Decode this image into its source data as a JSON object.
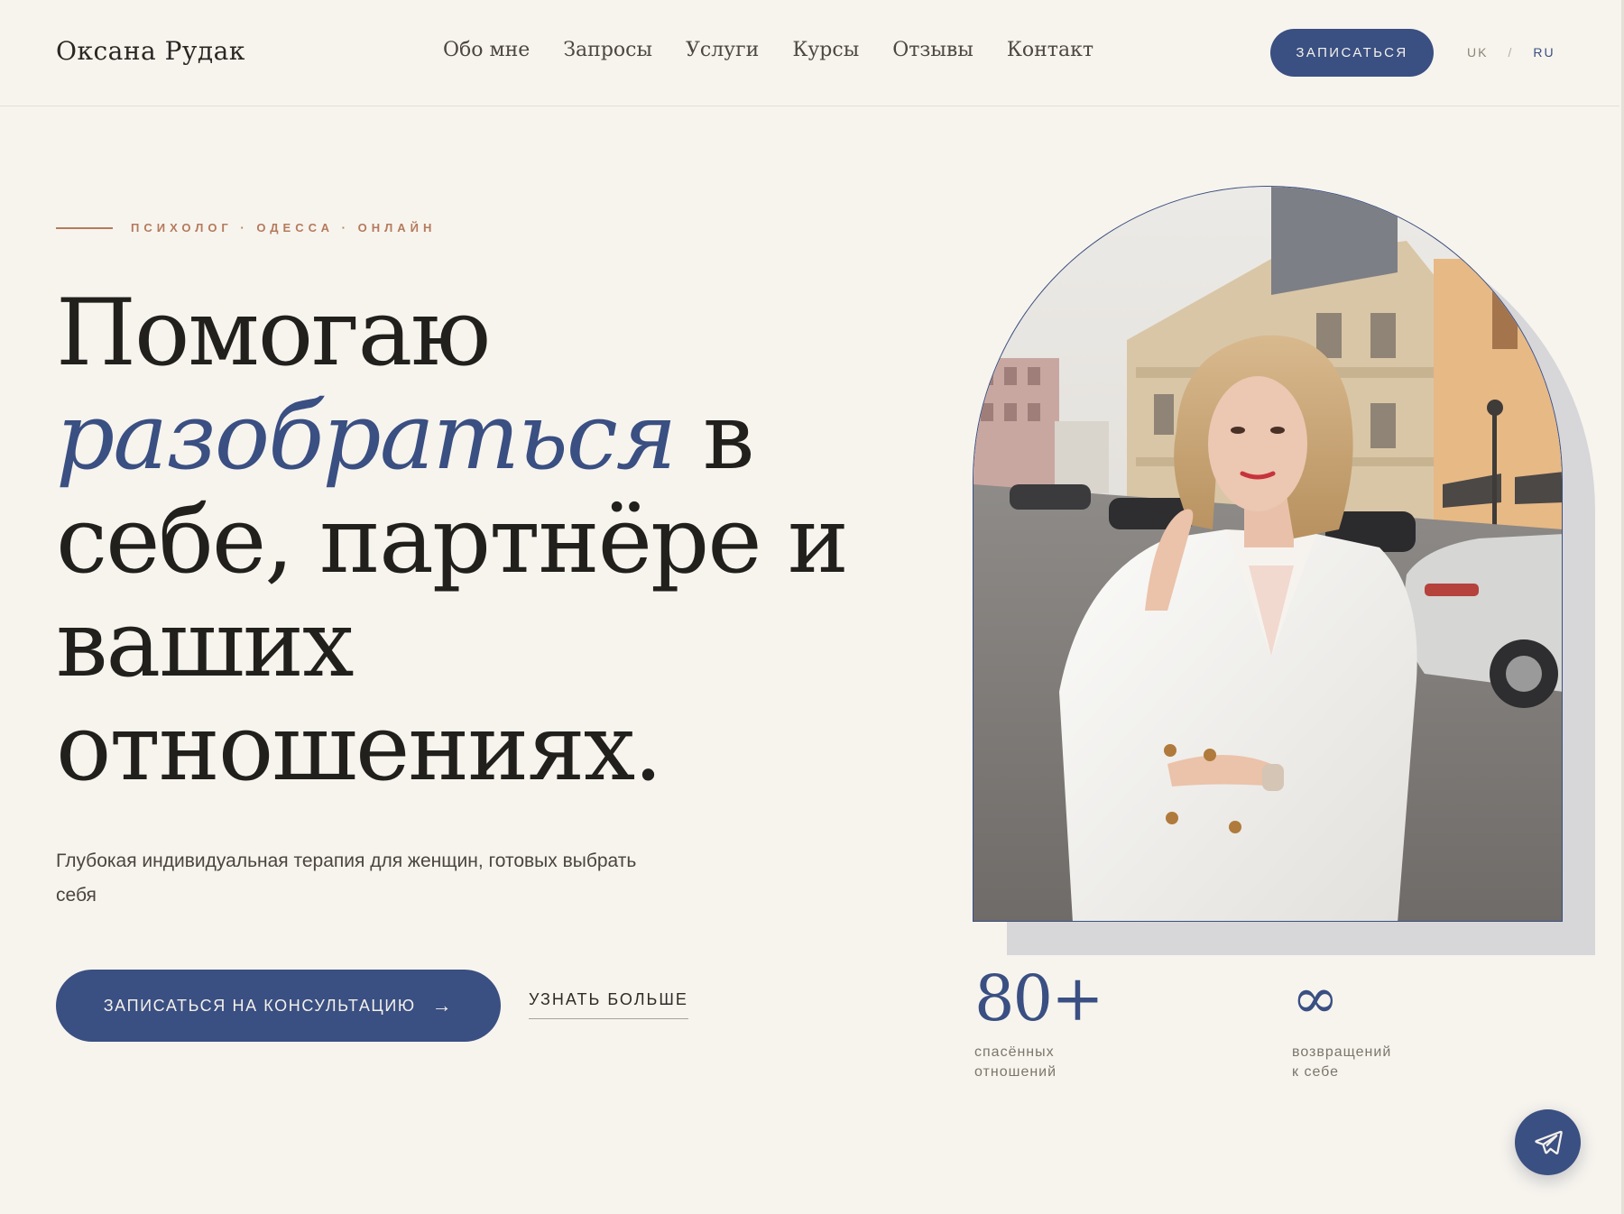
{
  "header": {
    "brand": "Оксана Рудак",
    "nav": [
      "Обо мне",
      "Запросы",
      "Услуги",
      "Курсы",
      "Отзывы",
      "Контакт"
    ],
    "cta_label": "ЗАПИСАТЬСЯ",
    "lang": {
      "uk": "UK",
      "separator": "/",
      "ru": "RU",
      "active": "RU"
    }
  },
  "hero": {
    "eyebrow": "ПСИХОЛОГ · ОДЕССА · ОНЛАЙН",
    "headline": {
      "line1": "Помогаю",
      "accent": "разобраться",
      "after_accent": "в",
      "line3": "себе, партнёре и",
      "line4": "ваших",
      "line5": "отношениях."
    },
    "lead": "Глубокая индивидуальная терапия для женщин, готовых выбрать себя",
    "primary_button": "ЗАПИСАТЬСЯ НА КОНСУЛЬТАЦИЮ",
    "primary_button_arrow": "→",
    "secondary_link": "УЗНАТЬ БОЛЬШЕ"
  },
  "stats": [
    {
      "value": "80+",
      "caption_line1": "спасённых",
      "caption_line2": "отношений"
    },
    {
      "value": "∞",
      "caption_line1": "возвращений",
      "caption_line2": "к себе"
    }
  ],
  "colors": {
    "accent": "#3a4f82",
    "terracotta": "#b57a5c",
    "background": "#f7f4ee",
    "text": "#22201c"
  },
  "icons": {
    "floating_button": "telegram-send-icon"
  }
}
